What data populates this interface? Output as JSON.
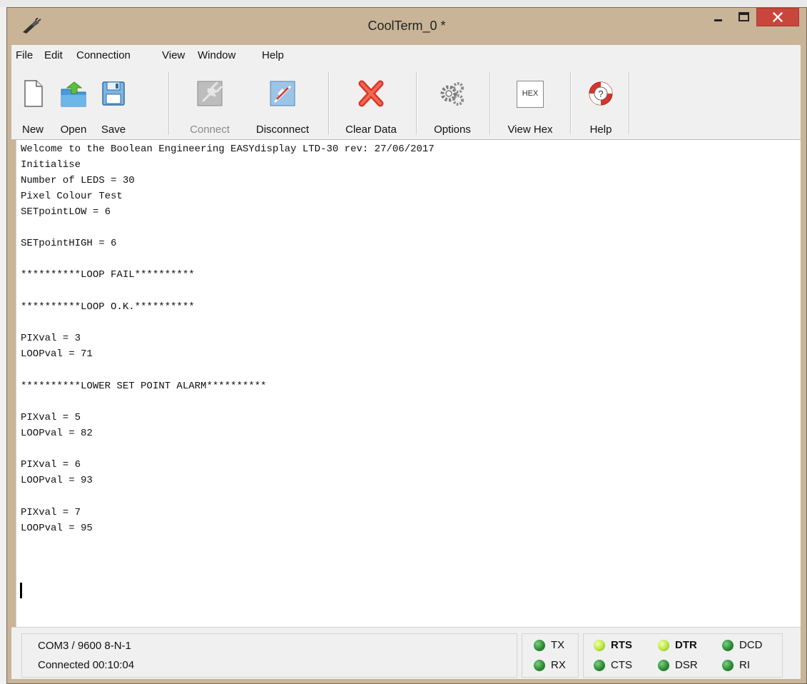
{
  "window": {
    "title": "CoolTerm_0 *"
  },
  "menu": [
    "File",
    "Edit",
    "Connection",
    "View",
    "Window",
    "Help"
  ],
  "toolbar": {
    "new": "New",
    "open": "Open",
    "save": "Save",
    "connect": "Connect",
    "disconnect": "Disconnect",
    "clear": "Clear Data",
    "options": "Options",
    "viewhex": "View Hex",
    "viewhex_icon_text": "HEX",
    "help": "Help"
  },
  "terminal": {
    "lines": [
      "Welcome to the Boolean Engineering EASYdisplay LTD-30 rev: 27/06/2017",
      "Initialise",
      "Number of LEDS = 30",
      "Pixel Colour Test",
      "SETpointLOW = 6",
      "SETpointHIGH = 6",
      "**********LOOP FAIL**********",
      "**********LOOP O.K.**********",
      "PIXval = 3",
      "LOOPval = 71",
      "**********LOWER SET POINT ALARM**********",
      "PIXval = 5",
      "LOOPval = 82",
      "PIXval = 6",
      "LOOPval = 93",
      "PIXval = 7",
      "LOOPval = 95"
    ]
  },
  "status": {
    "port": "COM3 / 9600 8-N-1",
    "connection": "Connected 00:10:04"
  },
  "leds": {
    "tx": "TX",
    "rx": "RX",
    "rts": "RTS",
    "cts": "CTS",
    "dtr": "DTR",
    "dsr": "DSR",
    "dcd": "DCD",
    "ri": "RI"
  },
  "colors": {
    "close_button": "#c9463d",
    "led_off": "#2e8b34",
    "led_on": "#b9e63a"
  }
}
